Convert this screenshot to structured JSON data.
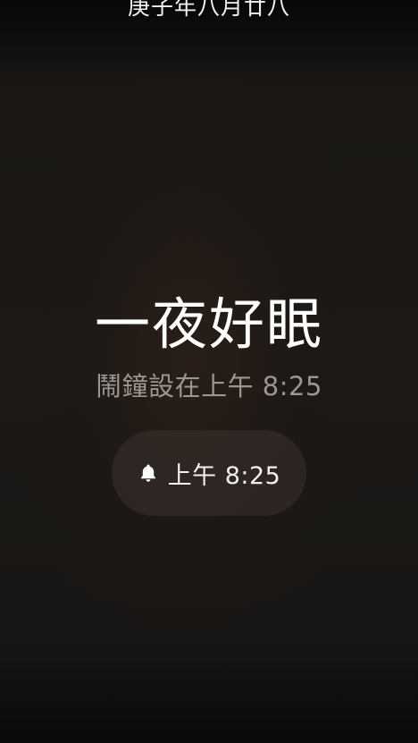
{
  "lunar_date": "庚子年八月廿八",
  "greeting": "一夜好眠",
  "alarm_subtitle": "鬧鐘設在上午 8:25",
  "alarm_button": {
    "icon": "bell-icon",
    "label": "上午 8:25"
  }
}
